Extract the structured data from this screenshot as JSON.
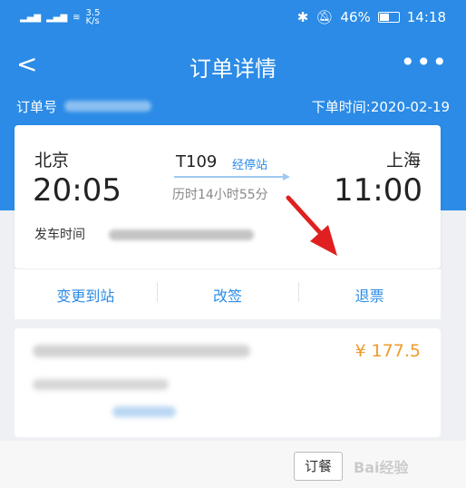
{
  "status_bar": {
    "network_speed": "3.5\nK/s",
    "battery": "46%",
    "time": "14:18"
  },
  "nav": {
    "back": "<",
    "title": "订单详情",
    "more": "•••"
  },
  "order": {
    "number_label": "订单号",
    "order_time": "下单时间:2020-02-19"
  },
  "trip": {
    "departure_city": "北京",
    "departure_time": "20:05",
    "arrival_city": "上海",
    "arrival_time": "11:00",
    "train_number": "T109",
    "stops_link": "经停站",
    "duration": "历时14小时55分",
    "depart_label": "发车时间"
  },
  "actions": {
    "change_station": "变更到站",
    "reschedule": "改签",
    "refund": "退票"
  },
  "passenger": {
    "price": "¥ 177.5"
  },
  "footer": {
    "meal_button": "订餐",
    "watermark": "Bai经验"
  },
  "colors": {
    "header_blue": "#2b8be6",
    "link_blue": "#2b8be6",
    "price_orange": "#f09a2a",
    "arrow_red": "#e02020"
  }
}
